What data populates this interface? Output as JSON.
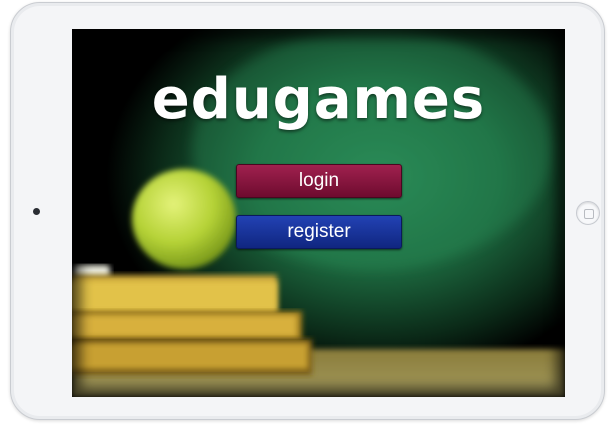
{
  "app": {
    "logo_text": "edugames"
  },
  "buttons": {
    "login_label": "login",
    "register_label": "register"
  },
  "colors": {
    "login_button": "#8a1540",
    "register_button": "#1a36a0",
    "chalkboard": "#1f6b45",
    "apple": "#b8d63a",
    "book": "#d6b83c"
  },
  "icons": {
    "camera": "front-camera-icon",
    "home": "home-button-icon"
  }
}
